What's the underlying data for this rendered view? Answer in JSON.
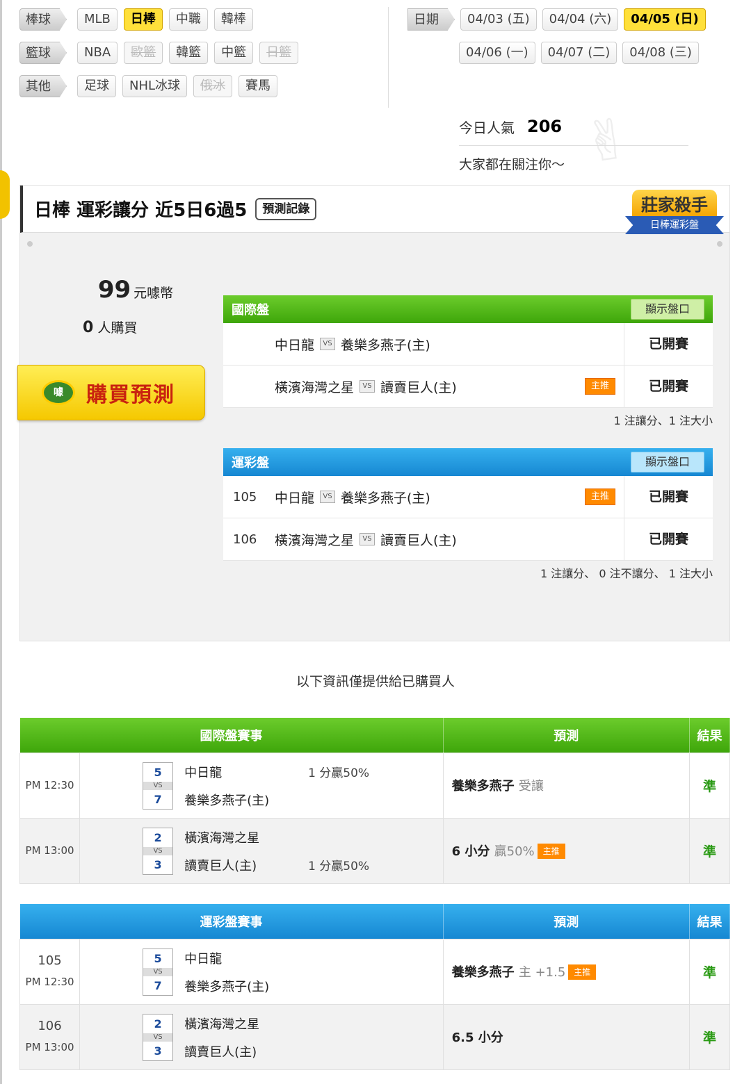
{
  "categories": [
    {
      "label": "棒球",
      "items": [
        {
          "text": "MLB",
          "state": "normal"
        },
        {
          "text": "日棒",
          "state": "on"
        },
        {
          "text": "中職",
          "state": "normal"
        },
        {
          "text": "韓棒",
          "state": "normal"
        }
      ]
    },
    {
      "label": "籃球",
      "items": [
        {
          "text": "NBA",
          "state": "normal"
        },
        {
          "text": "歐籃",
          "state": "disabled"
        },
        {
          "text": "韓籃",
          "state": "normal"
        },
        {
          "text": "中籃",
          "state": "normal"
        },
        {
          "text": "日籃",
          "state": "disabled"
        }
      ]
    },
    {
      "label": "其他",
      "items": [
        {
          "text": "足球",
          "state": "normal"
        },
        {
          "text": "NHL冰球",
          "state": "normal"
        },
        {
          "text": "俄冰",
          "state": "disabled"
        },
        {
          "text": "賽馬",
          "state": "normal"
        }
      ]
    }
  ],
  "dates": {
    "label": "日期",
    "row1": [
      {
        "text": "04/03 (五)",
        "state": "normal"
      },
      {
        "text": "04/04 (六)",
        "state": "normal"
      },
      {
        "text": "04/05 (日)",
        "state": "on"
      }
    ],
    "row2": [
      {
        "text": "04/06 (一)",
        "state": "normal"
      },
      {
        "text": "04/07 (二)",
        "state": "normal"
      },
      {
        "text": "04/08 (三)",
        "state": "normal"
      }
    ]
  },
  "popularity": {
    "label": "今日人氣",
    "value": "206",
    "subtitle": "大家都在關注你～"
  },
  "header": {
    "title_prefix": "日棒 運彩讓分",
    "title_record": "近5日6過5",
    "record_button": "預測記錄",
    "badge_top": "莊家殺手",
    "badge_ribbon": "日棒運彩盤"
  },
  "purchase": {
    "price": "99",
    "price_unit": "元噱幣",
    "buyers_count": "0",
    "buyers_label": "人購買",
    "buy_icon": "噱",
    "buy_button": "購買預測"
  },
  "intl_market": {
    "title": "國際盤",
    "show_button": "顯示盤口",
    "rows": [
      {
        "num": "",
        "away": "中日龍",
        "home": "養樂多燕子(主)",
        "main": false,
        "status": "已開賽"
      },
      {
        "num": "",
        "away": "橫濱海灣之星",
        "home": "讀賣巨人(主)",
        "main": true,
        "status": "已開賽"
      }
    ],
    "note": "1 注讓分、1 注大小"
  },
  "lottery_market": {
    "title": "運彩盤",
    "show_button": "顯示盤口",
    "rows": [
      {
        "num": "105",
        "away": "中日龍",
        "home": "養樂多燕子(主)",
        "main": true,
        "status": "已開賽"
      },
      {
        "num": "106",
        "away": "橫濱海灣之星",
        "home": "讀賣巨人(主)",
        "main": false,
        "status": "已開賽"
      }
    ],
    "note": "1 注讓分、 0 注不讓分、 1 注大小"
  },
  "main_tag": "主推",
  "vs_text": "VS",
  "info_text": "以下資訊僅提供給已購買人",
  "intl_table": {
    "headers": {
      "match": "國際盤賽事",
      "pred": "預測",
      "result": "結果"
    },
    "rows": [
      {
        "gid": "",
        "time": "PM 12:30",
        "s1": "5",
        "s2": "7",
        "team1": "中日龍",
        "team2": "養樂多燕子(主)",
        "hcap1": "1 分贏50%",
        "hcap2": "",
        "pred_main": "養樂多燕子",
        "pred_sub": "受讓",
        "pred_tag": false,
        "result": "準"
      },
      {
        "gid": "",
        "time": "PM 13:00",
        "s1": "2",
        "s2": "3",
        "team1": "橫濱海灣之星",
        "team2": "讀賣巨人(主)",
        "hcap1": "",
        "hcap2": "1 分贏50%",
        "pred_main": "6 小分",
        "pred_sub": "贏50%",
        "pred_tag": true,
        "result": "準"
      }
    ]
  },
  "lottery_table": {
    "headers": {
      "match": "運彩盤賽事",
      "pred": "預測",
      "result": "結果"
    },
    "rows": [
      {
        "gid": "105",
        "time": "PM 12:30",
        "s1": "5",
        "s2": "7",
        "team1": "中日龍",
        "team2": "養樂多燕子(主)",
        "hcap1": "",
        "hcap2": "",
        "pred_main": "養樂多燕子",
        "pred_sub": "主 +1.5",
        "pred_tag": true,
        "result": "準"
      },
      {
        "gid": "106",
        "time": "PM 13:00",
        "s1": "2",
        "s2": "3",
        "team1": "橫濱海灣之星",
        "team2": "讀賣巨人(主)",
        "hcap1": "",
        "hcap2": "",
        "pred_main": "6.5 小分",
        "pred_sub": "",
        "pred_tag": false,
        "result": "準"
      }
    ]
  }
}
